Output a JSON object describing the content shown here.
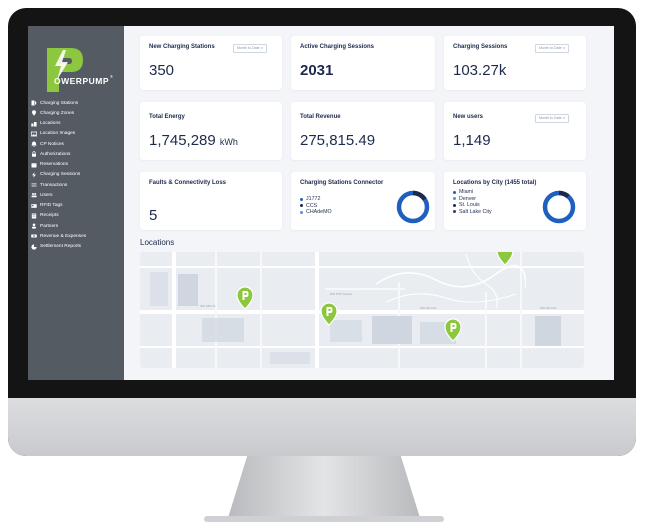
{
  "brand": {
    "name": "OWERPUMP",
    "trademark": "®",
    "colors": {
      "green": "#8dc63f",
      "navy": "#1d2a4d",
      "blue": "#1f5fbf"
    }
  },
  "sidebar": {
    "items": [
      {
        "label": "Charging Stations",
        "icon": "charging-station-icon"
      },
      {
        "label": "Charging Zones",
        "icon": "map-pin-icon"
      },
      {
        "label": "Locations",
        "icon": "locations-icon"
      },
      {
        "label": "Location Images",
        "icon": "image-icon"
      },
      {
        "label": "CP Notices",
        "icon": "bell-icon"
      },
      {
        "label": "Authorizations",
        "icon": "lock-icon"
      },
      {
        "label": "Reservations",
        "icon": "calendar-icon"
      },
      {
        "label": "Charging Sessions",
        "icon": "bolt-icon"
      },
      {
        "label": "Transactions",
        "icon": "transactions-icon"
      },
      {
        "label": "Users",
        "icon": "users-icon"
      },
      {
        "label": "RFID Tags",
        "icon": "card-icon"
      },
      {
        "label": "Receipts",
        "icon": "receipt-icon"
      },
      {
        "label": "Partners",
        "icon": "partner-icon"
      },
      {
        "label": "Revenue & Expenses",
        "icon": "money-icon"
      },
      {
        "label": "Settlement Reports",
        "icon": "report-icon"
      }
    ]
  },
  "cards": {
    "new_charging_stations": {
      "title": "New Charging Stations",
      "value": "350",
      "period": "Month to Date ∨"
    },
    "active_sessions": {
      "title": "Active Charging Sessions",
      "value": "2031"
    },
    "charging_sessions": {
      "title": "Charging Sessions",
      "value": "103.27k",
      "period": "Month to Date ∨"
    },
    "total_energy": {
      "title": "Total Energy",
      "value": "1,745,289",
      "unit": "kWh"
    },
    "total_revenue": {
      "title": "Total Revenue",
      "value": "275,815.49"
    },
    "new_users": {
      "title": "New users",
      "value": "1,149",
      "period": "Month to Date ∨"
    },
    "faults": {
      "title": "Faults & Connectivity Loss",
      "value": "5"
    },
    "connectors": {
      "title": "Charging Stations Connector",
      "items": [
        {
          "label": "J1772",
          "color": "#1f5fbf"
        },
        {
          "label": "CCS",
          "color": "#1d2a4d"
        },
        {
          "label": "CHAdeMO",
          "color": "#5b8fd6"
        }
      ]
    },
    "cities": {
      "title": "Locations by City (1455 total)",
      "items": [
        {
          "label": "Miami",
          "color": "#1f5fbf"
        },
        {
          "label": "Denver",
          "color": "#5b8fd6"
        },
        {
          "label": "St. Louis",
          "color": "#1d2a4d"
        },
        {
          "label": "Salt Lake City",
          "color": "#2c3e6b"
        }
      ]
    }
  },
  "locations_section": {
    "title": "Locations"
  }
}
